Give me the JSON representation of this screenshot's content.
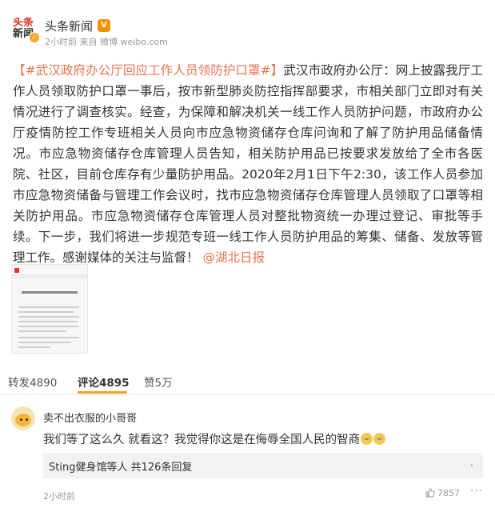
{
  "post": {
    "avatar_line1": "头条",
    "avatar_line2": "新闻",
    "author": "头条新闻",
    "member_badge": "V",
    "time": "2小时前",
    "source": "来自 微博 weibo.com",
    "hashtag": "【#武汉政府办公厅回应工作人员领防护口罩#】",
    "body": "武汉市政府办公厅：网上披露我厅工作人员领取防护口罩一事后，按市新型肺炎防控指挥部要求，市相关部门立即对有关情况进行了调查核实。经查，为保障和解决机关一线工作人员防护问题，市政府办公厅疫情防控工作专班相关人员向市应急物资储存仓库问询和了解了防护用品储备情况。市应急物资储存仓库管理人员告知，相关防护用品已按要求发放给了全市各医院、社区，目前仓库存有少量防护用品。2020年2月1日下午2:30，该工作人员参加市应急物资储备与管理工作会议时，找市应急物资储存仓库管理人员领取了口罩等相关防护用品。市应急物资储存仓库管理人员对整批物资统一办理过登记、审批等手续。下一步，我们将进一步规范专班一线工作人员防护用品的筹集、储备、发放等管理工作。感谢媒体的关注与监督！",
    "mention": "@湖北日报"
  },
  "actions": {
    "repost": "转发4890",
    "comment": "评论4895",
    "like": "赞5万"
  },
  "comment": {
    "user": "卖不出衣服的小哥哥",
    "text": "我们等了这么久 就看这？我觉得你这是在侮辱全国人民的智商",
    "replies": "Sting健身馆等人 共126条回复",
    "time": "2小时前",
    "likes": "7857",
    "more": "···"
  },
  "colors": {
    "accent": "#eb7350",
    "tab_indicator": "#f7a123"
  },
  "icons": [
    "verified-icon",
    "member-icon",
    "chevron-right-icon",
    "thumb-up-icon",
    "more-icon"
  ]
}
